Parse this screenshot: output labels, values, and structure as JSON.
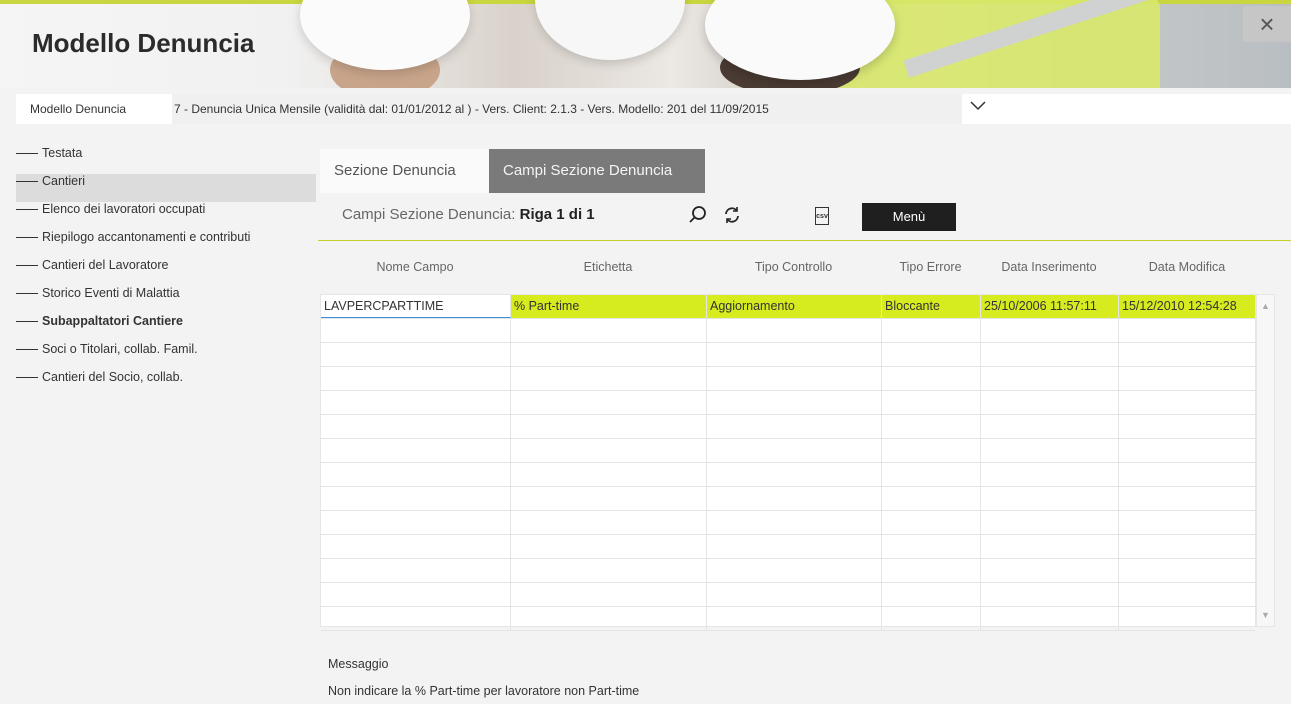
{
  "header": {
    "title": "Modello Denuncia",
    "close_symbol": "×"
  },
  "model": {
    "label": "Modello Denuncia",
    "selected": "7 - Denuncia Unica Mensile (validità dal: 01/01/2012 al ) - Vers. Client: 2.1.3 - Vers. Modello: 201 del 11/09/2015"
  },
  "sidebar": {
    "items": [
      {
        "label": "Testata"
      },
      {
        "label": "Cantieri"
      },
      {
        "label": "Elenco dei lavoratori occupati"
      },
      {
        "label": "Riepilogo accantonamenti e contributi"
      },
      {
        "label": "Cantieri del Lavoratore"
      },
      {
        "label": "Storico Eventi di Malattia"
      },
      {
        "label": "Subappaltatori Cantiere"
      },
      {
        "label": "Soci o Titolari, collab. Famil."
      },
      {
        "label": "Cantieri del Socio, collab."
      }
    ]
  },
  "tabs": [
    {
      "label": "Sezione Denuncia"
    },
    {
      "label": "Campi Sezione Denuncia"
    }
  ],
  "toolbar": {
    "title": "Campi Sezione Denuncia:",
    "record": "Riga 1 di 1",
    "csv": "csv",
    "menu_label": "Menù"
  },
  "grid": {
    "columns": [
      "Nome Campo",
      "Etichetta",
      "Tipo Controllo",
      "Tipo Errore",
      "Data Inserimento",
      "Data Modifica"
    ],
    "rows": [
      [
        "LAVPERCPARTTIME",
        "% Part-time",
        "Aggiornamento",
        "Bloccante",
        "25/10/2006 11:57:11",
        "15/12/2010 12:54:28"
      ]
    ]
  },
  "message": {
    "label": "Messaggio",
    "text": "Non indicare la % Part-time per lavoratore non Part-time"
  },
  "colors": {
    "accent": "#c5d12b",
    "highlight": "#d6ec1f",
    "tab_active": "#7a7a7a",
    "menu_button": "#1f1f1f"
  }
}
